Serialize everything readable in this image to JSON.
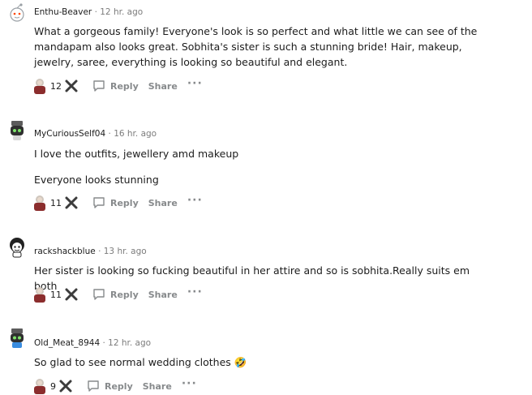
{
  "comments": [
    {
      "username": "Enthu-Beaver",
      "time": "12 hr. ago",
      "avatar": "snoo-avatar-default",
      "paragraphs": [
        "What a gorgeous family! Everyone's look is so perfect and what little we can see of the mandapam also looks great. Sobhita's sister is such a stunning bride! Hair, makeup, jewelry, saree, everything is looking so beautiful and elegant."
      ],
      "award_count": "12"
    },
    {
      "username": "MyCuriousSelf04",
      "time": "16 hr. ago",
      "avatar": "snoo-avatar-robot",
      "paragraphs": [
        "I love the outfits, jewellery amd makeup",
        "Everyone looks stunning"
      ],
      "award_count": "11"
    },
    {
      "username": "rackshackblue",
      "time": "13 hr. ago",
      "avatar": "snoo-avatar-curly",
      "paragraphs": [
        "Her sister is looking so fucking beautiful in her attire and so is sobhita.Really suits em both"
      ],
      "award_count": "11"
    },
    {
      "username": "Old_Meat_8944",
      "time": "12 hr. ago",
      "avatar": "snoo-avatar-robot-blue",
      "paragraphs": [
        "So glad to see normal wedding clothes 🤣"
      ],
      "award_count": "9"
    }
  ],
  "actions": {
    "reply": "Reply",
    "share": "Share",
    "more": "···",
    "separator": "·"
  },
  "colors": {
    "meta": "#7c7c7c",
    "actions": "#878a8c",
    "text": "#1c1c1c"
  }
}
